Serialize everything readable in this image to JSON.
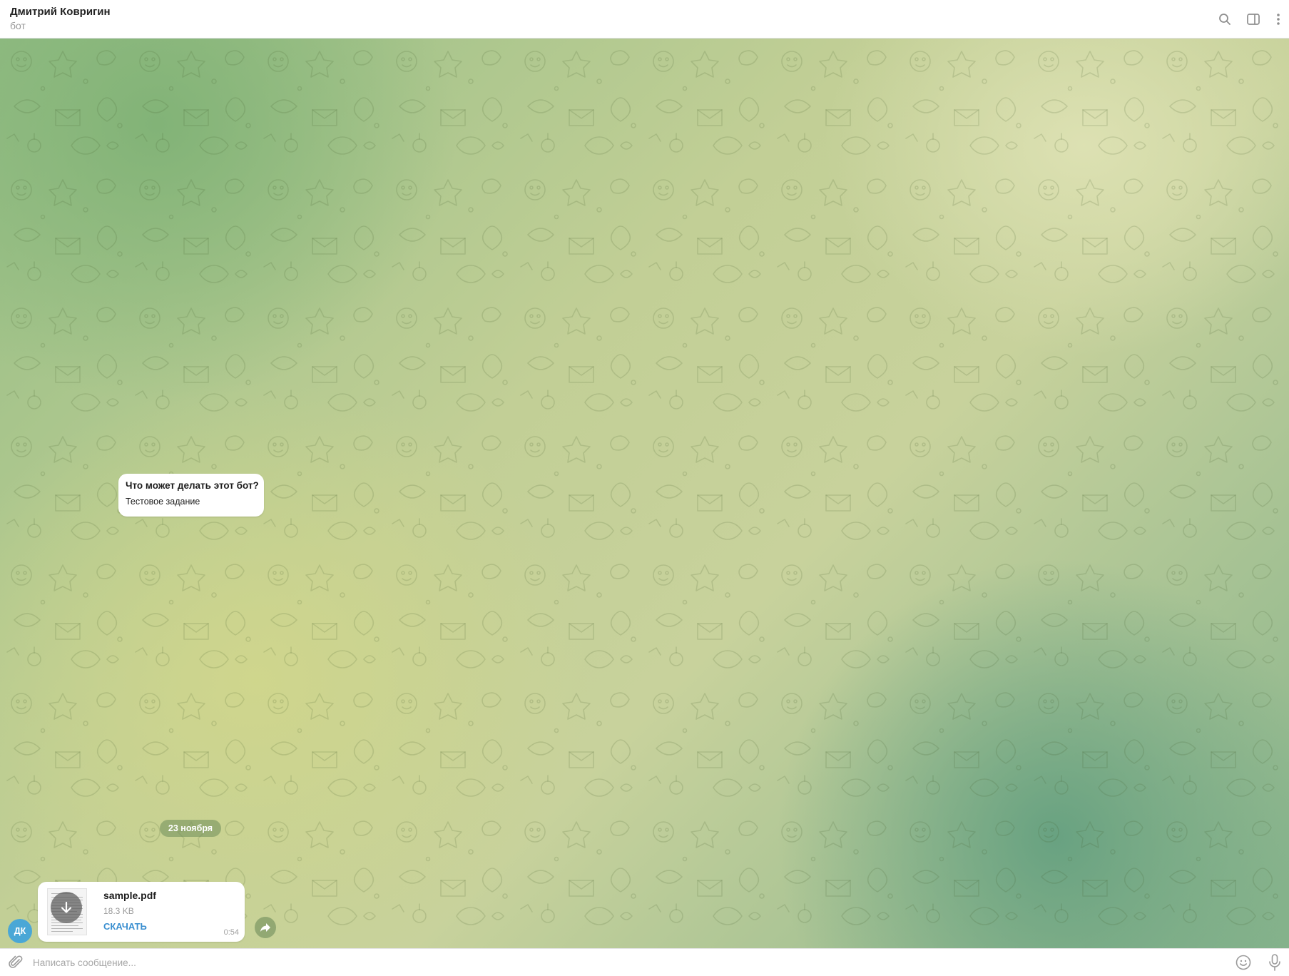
{
  "header": {
    "title": "Дмитрий Ковригин",
    "status": "бот",
    "icons": [
      "search-icon",
      "sidebar-toggle-icon",
      "more-vertical-icon"
    ]
  },
  "info_card": {
    "title": "Что может делать этот бот?",
    "text": "Тестовое задание"
  },
  "date_separator": "23 ноября",
  "avatar": {
    "initials": "ДК",
    "color": "#4aa7d6"
  },
  "file_message": {
    "file_name": "sample.pdf",
    "file_size": "18.3 KB",
    "download_label": "СКАЧАТЬ",
    "time": "0:54"
  },
  "composer": {
    "placeholder": "Написать сообщение...",
    "value": ""
  },
  "colors": {
    "accent": "#3a8fd0",
    "header_bg": "#ffffff",
    "bubble_bg": "#ffffff"
  }
}
